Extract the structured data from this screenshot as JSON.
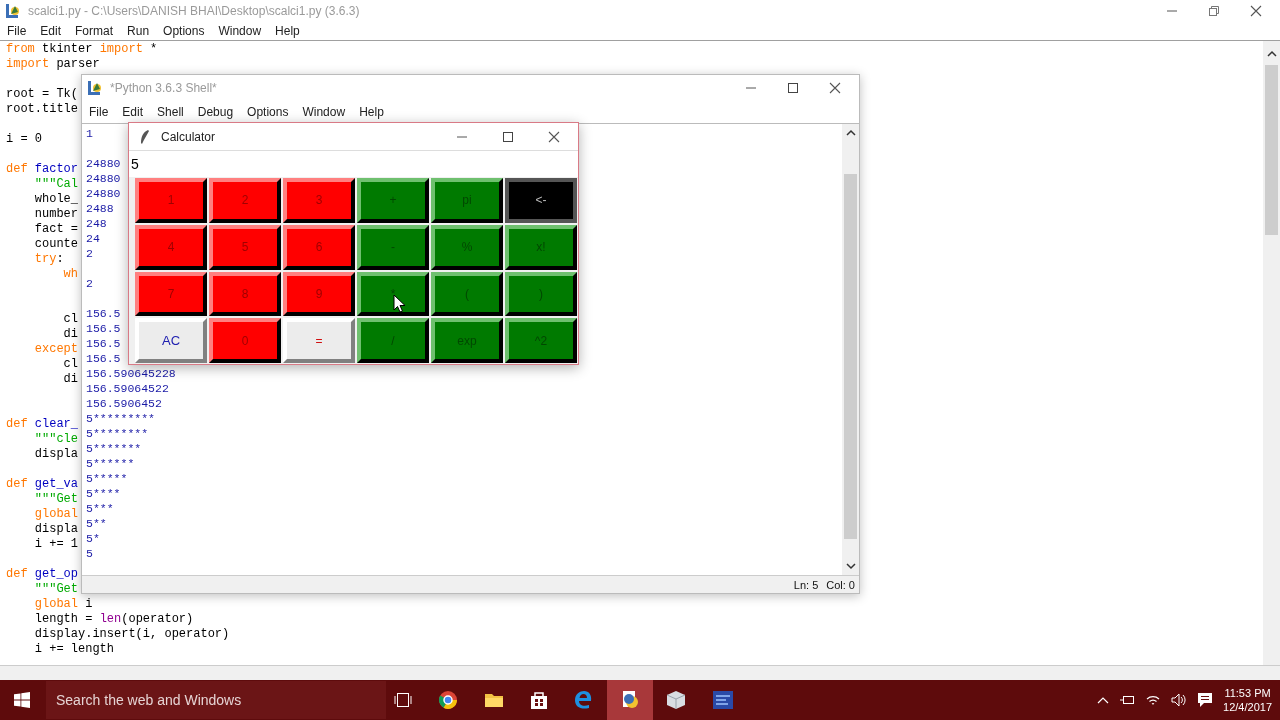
{
  "editor_window": {
    "title": "scalci1.py - C:\\Users\\DANISH BHAI\\Desktop\\scalci1.py (3.6.3)",
    "menu": [
      "File",
      "Edit",
      "Format",
      "Run",
      "Options",
      "Window",
      "Help"
    ],
    "lines": [
      {
        "kind": "code",
        "tokens": [
          {
            "kind": "keyword",
            "text": "from"
          },
          {
            "kind": "plain",
            "text": " tkinter "
          },
          {
            "kind": "keyword",
            "text": "import"
          },
          {
            "kind": "plain",
            "text": " *"
          }
        ]
      },
      {
        "kind": "code",
        "tokens": [
          {
            "kind": "keyword",
            "text": "import"
          },
          {
            "kind": "plain",
            "text": " parser"
          }
        ]
      },
      {
        "kind": "blank"
      },
      {
        "kind": "code",
        "tokens": [
          {
            "kind": "plain",
            "text": "root = Tk("
          }
        ]
      },
      {
        "kind": "code",
        "tokens": [
          {
            "kind": "plain",
            "text": "root.title"
          }
        ]
      },
      {
        "kind": "blank"
      },
      {
        "kind": "code",
        "tokens": [
          {
            "kind": "plain",
            "text": "i = 0"
          }
        ]
      },
      {
        "kind": "blank"
      },
      {
        "kind": "code",
        "tokens": [
          {
            "kind": "keyword",
            "text": "def"
          },
          {
            "kind": "definition",
            "text": " factor"
          }
        ]
      },
      {
        "kind": "code",
        "tokens": [
          {
            "kind": "string",
            "text": "    \"\"\"Cal"
          }
        ]
      },
      {
        "kind": "code",
        "tokens": [
          {
            "kind": "plain",
            "text": "    whole_"
          }
        ]
      },
      {
        "kind": "code",
        "tokens": [
          {
            "kind": "plain",
            "text": "    number"
          }
        ]
      },
      {
        "kind": "code",
        "tokens": [
          {
            "kind": "plain",
            "text": "    fact ="
          }
        ]
      },
      {
        "kind": "code",
        "tokens": [
          {
            "kind": "plain",
            "text": "    counte"
          }
        ]
      },
      {
        "kind": "code",
        "tokens": [
          {
            "kind": "keyword",
            "text": "    try"
          },
          {
            "kind": "plain",
            "text": ":"
          }
        ]
      },
      {
        "kind": "code",
        "tokens": [
          {
            "kind": "keyword",
            "text": "        wh"
          }
        ]
      },
      {
        "kind": "blank"
      },
      {
        "kind": "blank"
      },
      {
        "kind": "code",
        "tokens": [
          {
            "kind": "plain",
            "text": "        cl"
          }
        ]
      },
      {
        "kind": "code",
        "tokens": [
          {
            "kind": "plain",
            "text": "        di"
          }
        ]
      },
      {
        "kind": "code",
        "tokens": [
          {
            "kind": "keyword",
            "text": "    except"
          }
        ]
      },
      {
        "kind": "code",
        "tokens": [
          {
            "kind": "plain",
            "text": "        cl"
          }
        ]
      },
      {
        "kind": "code",
        "tokens": [
          {
            "kind": "plain",
            "text": "        di"
          }
        ]
      },
      {
        "kind": "blank"
      },
      {
        "kind": "blank"
      },
      {
        "kind": "code",
        "tokens": [
          {
            "kind": "keyword",
            "text": "def"
          },
          {
            "kind": "definition",
            "text": " clear_"
          }
        ]
      },
      {
        "kind": "code",
        "tokens": [
          {
            "kind": "string",
            "text": "    \"\"\"cle"
          }
        ]
      },
      {
        "kind": "code",
        "tokens": [
          {
            "kind": "plain",
            "text": "    displa"
          }
        ]
      },
      {
        "kind": "blank"
      },
      {
        "kind": "code",
        "tokens": [
          {
            "kind": "keyword",
            "text": "def"
          },
          {
            "kind": "definition",
            "text": " get_va"
          }
        ]
      },
      {
        "kind": "code",
        "tokens": [
          {
            "kind": "string",
            "text": "    \"\"\"Get"
          }
        ]
      },
      {
        "kind": "code",
        "tokens": [
          {
            "kind": "keyword",
            "text": "    global"
          }
        ]
      },
      {
        "kind": "code",
        "tokens": [
          {
            "kind": "plain",
            "text": "    displa"
          }
        ]
      },
      {
        "kind": "code",
        "tokens": [
          {
            "kind": "plain",
            "text": "    i += 1"
          }
        ]
      },
      {
        "kind": "blank"
      },
      {
        "kind": "code",
        "tokens": [
          {
            "kind": "keyword",
            "text": "def"
          },
          {
            "kind": "definition",
            "text": " get_op"
          }
        ]
      },
      {
        "kind": "code",
        "tokens": [
          {
            "kind": "string",
            "text": "    \"\"\"Get"
          }
        ]
      },
      {
        "kind": "code",
        "tokens": [
          {
            "kind": "keyword",
            "text": "    global"
          },
          {
            "kind": "plain",
            "text": " i"
          }
        ]
      },
      {
        "kind": "code",
        "tokens": [
          {
            "kind": "plain",
            "text": "    length = "
          },
          {
            "kind": "builtin",
            "text": "len"
          },
          {
            "kind": "plain",
            "text": "(operator)"
          }
        ]
      },
      {
        "kind": "code",
        "tokens": [
          {
            "kind": "plain",
            "text": "    display.insert(i, operator)"
          }
        ]
      },
      {
        "kind": "code",
        "tokens": [
          {
            "kind": "plain",
            "text": "    i += length"
          }
        ]
      }
    ]
  },
  "shell_window": {
    "title": "*Python 3.6.3 Shell*",
    "menu": [
      "File",
      "Edit",
      "Shell",
      "Debug",
      "Options",
      "Window",
      "Help"
    ],
    "lines": [
      {
        "kind": "output",
        "text": "1"
      },
      {
        "kind": "blank"
      },
      {
        "kind": "output",
        "text": "24880"
      },
      {
        "kind": "output",
        "text": "24880"
      },
      {
        "kind": "output",
        "text": "24880"
      },
      {
        "kind": "output",
        "text": "2488"
      },
      {
        "kind": "output",
        "text": "248"
      },
      {
        "kind": "output",
        "text": "24"
      },
      {
        "kind": "output",
        "text": "2"
      },
      {
        "kind": "blank"
      },
      {
        "kind": "output",
        "text": "2"
      },
      {
        "kind": "blank"
      },
      {
        "kind": "output",
        "text": "156.5"
      },
      {
        "kind": "output",
        "text": "156.5"
      },
      {
        "kind": "output",
        "text": "156.5"
      },
      {
        "kind": "output",
        "text": "156.5"
      },
      {
        "kind": "output",
        "text": "156.590645228"
      },
      {
        "kind": "output",
        "text": "156.59064522"
      },
      {
        "kind": "output",
        "text": "156.5906452"
      },
      {
        "kind": "output",
        "text": "5*********"
      },
      {
        "kind": "output",
        "text": "5********"
      },
      {
        "kind": "output",
        "text": "5*******"
      },
      {
        "kind": "output",
        "text": "5******"
      },
      {
        "kind": "output",
        "text": "5*****"
      },
      {
        "kind": "output",
        "text": "5****"
      },
      {
        "kind": "output",
        "text": "5***"
      },
      {
        "kind": "output",
        "text": "5**"
      },
      {
        "kind": "output",
        "text": "5*"
      },
      {
        "kind": "output",
        "text": "5"
      }
    ],
    "status": {
      "line": "Ln: 5",
      "column": "Col: 0"
    }
  },
  "calculator_window": {
    "title": "Calculator",
    "display": "5",
    "buttons": [
      {
        "label": "1",
        "kind": "digit"
      },
      {
        "label": "2",
        "kind": "digit"
      },
      {
        "label": "3",
        "kind": "digit"
      },
      {
        "label": "+",
        "kind": "operator"
      },
      {
        "label": "pi",
        "kind": "operator"
      },
      {
        "label": "<-",
        "kind": "backspace"
      },
      {
        "label": "4",
        "kind": "digit"
      },
      {
        "label": "5",
        "kind": "digit"
      },
      {
        "label": "6",
        "kind": "digit"
      },
      {
        "label": "-",
        "kind": "operator"
      },
      {
        "label": "%",
        "kind": "operator"
      },
      {
        "label": "x!",
        "kind": "operator"
      },
      {
        "label": "7",
        "kind": "digit"
      },
      {
        "label": "8",
        "kind": "digit"
      },
      {
        "label": "9",
        "kind": "digit"
      },
      {
        "label": "*",
        "kind": "operator"
      },
      {
        "label": "(",
        "kind": "operator"
      },
      {
        "label": ")",
        "kind": "operator"
      },
      {
        "label": "AC",
        "kind": "clear"
      },
      {
        "label": "0",
        "kind": "digit"
      },
      {
        "label": "=",
        "kind": "equals"
      },
      {
        "label": "/",
        "kind": "operator"
      },
      {
        "label": "exp",
        "kind": "operator"
      },
      {
        "label": "^2",
        "kind": "operator"
      }
    ]
  },
  "taskbar": {
    "search": {
      "placeholder": "Search the web and Windows"
    },
    "time": "11:53 PM",
    "date": "12/4/2017"
  }
}
